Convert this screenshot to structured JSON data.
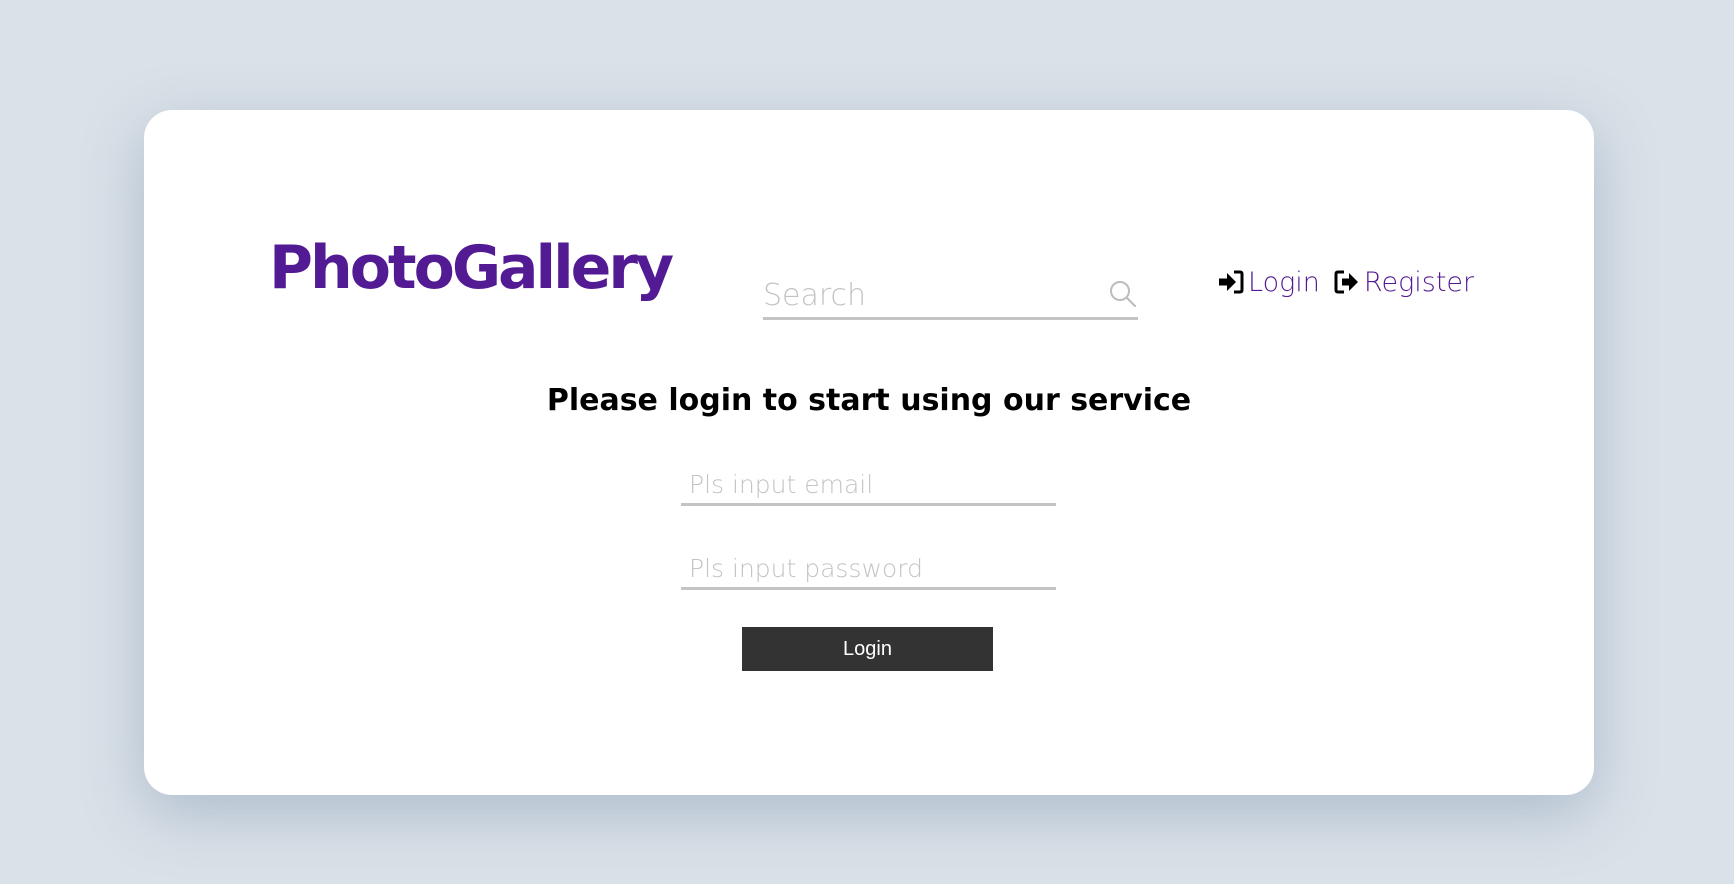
{
  "header": {
    "logo_text": "PhotoGallery",
    "search": {
      "placeholder": "Search",
      "value": "",
      "icon": "search-icon"
    },
    "nav": {
      "login_label": "Login",
      "login_icon": "sign-in-icon",
      "register_label": "Register",
      "register_icon": "sign-out-icon"
    }
  },
  "main": {
    "heading": "Please login to start using our service",
    "email_field": {
      "placeholder": "Pls input email",
      "value": ""
    },
    "password_field": {
      "placeholder": "Pls input password",
      "value": ""
    },
    "login_button_label": "Login"
  },
  "colors": {
    "brand": "#531b93",
    "page_background": "#dae1e8",
    "card_background": "#ffffff",
    "button_background": "#333333",
    "input_underline": "#c4c4c4",
    "placeholder_text": "#c3c3c3"
  }
}
